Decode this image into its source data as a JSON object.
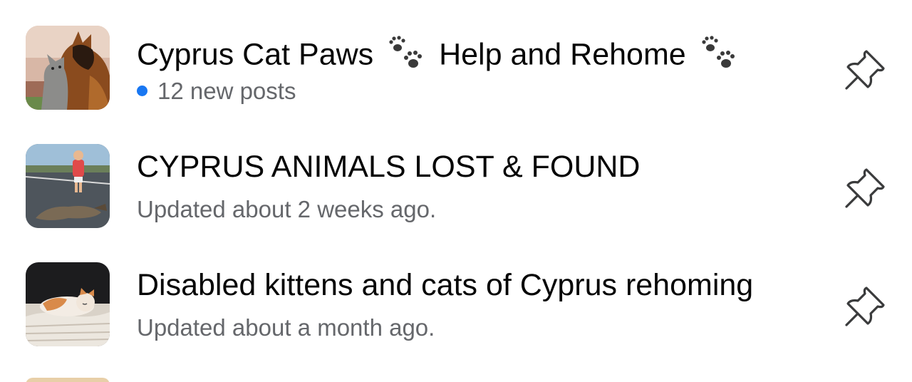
{
  "groups": [
    {
      "name_part1": "Cyprus Cat Paws",
      "name_part2": "Help and Rehome",
      "status": "12 new posts",
      "has_new": true,
      "thumb_icon": "cat-and-dog-photo",
      "pin_icon": "pushpin-icon"
    },
    {
      "name": "CYPRUS ANIMALS LOST & FOUND",
      "status": "Updated about 2 weeks ago.",
      "has_new": false,
      "thumb_icon": "child-and-dog-on-road-photo",
      "pin_icon": "pushpin-icon"
    },
    {
      "name": "Disabled kittens and cats of Cyprus rehoming",
      "status": "Updated about a month ago.",
      "has_new": false,
      "thumb_icon": "sleeping-kitten-photo",
      "pin_icon": "pushpin-icon"
    }
  ],
  "colors": {
    "new_dot": "#1877f2",
    "title": "#050505",
    "subtitle": "#65676b"
  }
}
